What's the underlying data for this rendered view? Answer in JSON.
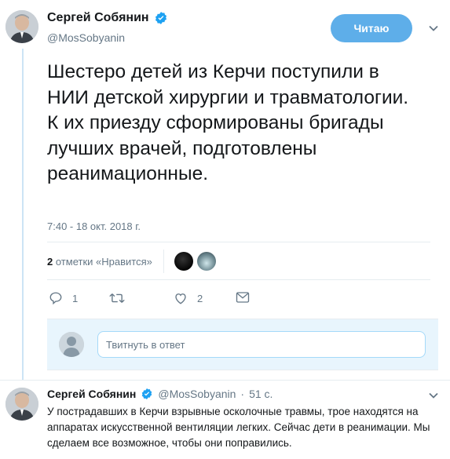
{
  "tweet": {
    "author_name": "Сергей Собянин",
    "handle": "@MosSobyanin",
    "follow_label": "Читаю",
    "text": "Шестеро детей из Керчи поступили в НИИ детской хирургии и травматологии. К их приезду сформированы бригады лучших врачей, подготовлены реанимационные.",
    "timestamp": "7:40 - 18 окт. 2018 г.",
    "likes_count": "2",
    "likes_label": "отметки «Нравится»",
    "actions": {
      "reply_count": "1",
      "retweet_count": "",
      "like_count": "2"
    }
  },
  "reply_box": {
    "placeholder": "Твитнуть в ответ"
  },
  "reply_tweet": {
    "author_name": "Сергей Собянин",
    "handle": "@MosSobyanin",
    "separator": "·",
    "time_ago": "51 с.",
    "text": "У пострадавших в Керчи взрывные осколочные травмы, трое находятся на аппаратах искусственной вентиляции легких. Сейчас дети в реанимации. Мы сделаем все возможное, чтобы они поправились."
  },
  "colors": {
    "accent": "#5eaee9",
    "verified": "#1da1f2",
    "muted": "#657786"
  },
  "icons": [
    "verified-icon",
    "chevron-down-icon",
    "reply-icon",
    "retweet-icon",
    "like-icon",
    "message-icon"
  ]
}
